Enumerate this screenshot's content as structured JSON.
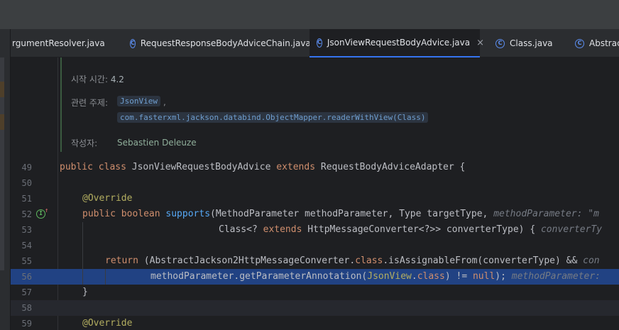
{
  "tabs": [
    {
      "label": "rgumentResolver.java",
      "icon": "class-icon",
      "active": false
    },
    {
      "label": "RequestResponseBodyAdviceChain.java",
      "icon": "class-icon",
      "active": false
    },
    {
      "label": "JsonViewRequestBodyAdvice.java",
      "icon": "class-icon",
      "active": true
    },
    {
      "label": "Class.java",
      "icon": "class-icon",
      "active": false
    },
    {
      "label": "AbstractJ",
      "icon": "class-icon",
      "active": false
    }
  ],
  "tab_close": "×",
  "class_icon_glyph": "C",
  "doc": {
    "since_label": "시작 시간:",
    "since_value": "4.2",
    "see_label": "관련 주제:",
    "see_link1": "JsonView",
    "see_sep": ",",
    "see_link2": "com.fasterxml.jackson.databind.ObjectMapper.readerWithView(Class)",
    "author_label": "작성자:",
    "author_value": "Sebastien Deleuze"
  },
  "lines": [
    {
      "n": "49",
      "parts": [
        [
          "kw",
          "public class "
        ],
        [
          "cls",
          "JsonViewRequestBodyAdvice "
        ],
        [
          "kw",
          "extends "
        ],
        [
          "cls",
          "RequestBodyAdviceAdapter {"
        ]
      ]
    },
    {
      "n": "50",
      "parts": []
    },
    {
      "n": "51",
      "parts": [
        [
          "ann",
          "@Override"
        ]
      ]
    },
    {
      "n": "52",
      "parts": [
        [
          "kw",
          "public boolean "
        ],
        [
          "fn",
          "supports"
        ],
        [
          "cls",
          "(MethodParameter methodParameter, Type targetType,  "
        ],
        [
          "hint",
          "methodParameter: \"m"
        ]
      ]
    },
    {
      "n": "53",
      "parts": [
        [
          "cls",
          "Class<? "
        ],
        [
          "kw",
          "extends "
        ],
        [
          "cls",
          "HttpMessageConverter<?>> converterType) {  "
        ],
        [
          "hint",
          "converterTy"
        ]
      ]
    },
    {
      "n": "54",
      "parts": []
    },
    {
      "n": "55",
      "parts": [
        [
          "kw",
          "return "
        ],
        [
          "cls",
          "(AbstractJackson2HttpMessageConverter."
        ],
        [
          "kw",
          "class"
        ],
        [
          "cls",
          ".isAssignableFrom(converterType) &&  "
        ],
        [
          "hint",
          "con"
        ]
      ]
    },
    {
      "n": "56",
      "parts": [
        [
          "cls",
          "methodParameter.getParameterAnnotation("
        ],
        [
          "ann",
          "JsonView"
        ],
        [
          "cls",
          "."
        ],
        [
          "kw",
          "class"
        ],
        [
          "cls",
          ") != "
        ],
        [
          "kw",
          "null"
        ],
        [
          "cls",
          ");  "
        ],
        [
          "hint",
          "methodParameter:"
        ]
      ]
    },
    {
      "n": "57",
      "parts": [
        [
          "cls",
          "}"
        ]
      ]
    },
    {
      "n": "58",
      "parts": []
    },
    {
      "n": "59",
      "parts": [
        [
          "ann",
          "@Override"
        ]
      ]
    }
  ],
  "gutter_icon": "implements-icon",
  "gutter_glyph": "I",
  "gutter_arrow": "↑"
}
